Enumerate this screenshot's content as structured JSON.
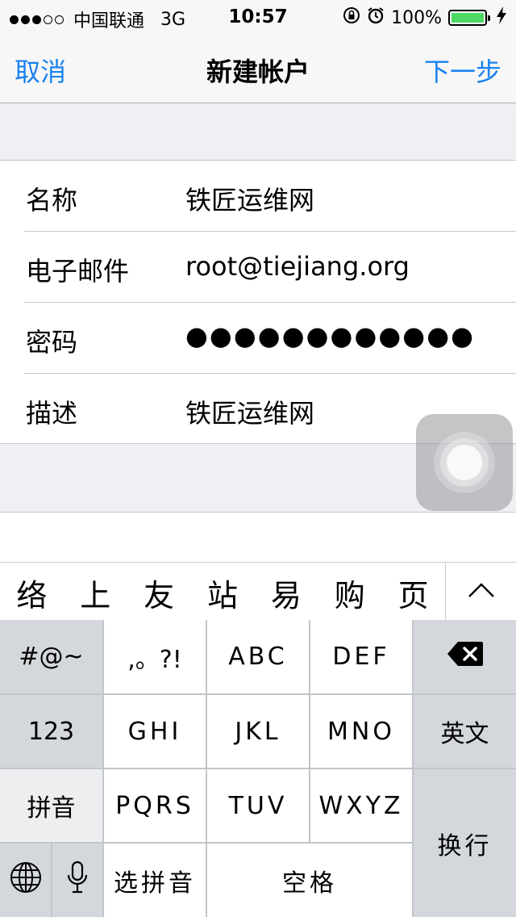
{
  "status_bar": {
    "carrier": "中国联通",
    "network": "3G",
    "time": "10:57",
    "battery_percent": "100%",
    "battery_color": "#4cd964"
  },
  "nav": {
    "left_label": "取消",
    "title": "新建帐户",
    "right_label": "下一步",
    "accent_color": "#1a82f0"
  },
  "form": {
    "rows": [
      {
        "label": "名称",
        "value": "铁匠运维网"
      },
      {
        "label": "电子邮件",
        "value": "root@tiejiang.org"
      },
      {
        "label": "密码",
        "value": "●●●●●●●●●●●●"
      },
      {
        "label": "描述",
        "value": "铁匠运维网"
      }
    ]
  },
  "candidates": {
    "items": [
      "络",
      "上",
      "友",
      "站",
      "易",
      "购",
      "页"
    ]
  },
  "keyboard": {
    "row1": [
      "#@~",
      ",。?!",
      "ABC",
      "DEF"
    ],
    "row2": [
      "123",
      "GHI",
      "JKL",
      "MNO",
      "英文"
    ],
    "row3": [
      "拼音",
      "PQRS",
      "TUV",
      "WXYZ"
    ],
    "row4": [
      "选拼音",
      "空格"
    ],
    "enter": "换行"
  }
}
